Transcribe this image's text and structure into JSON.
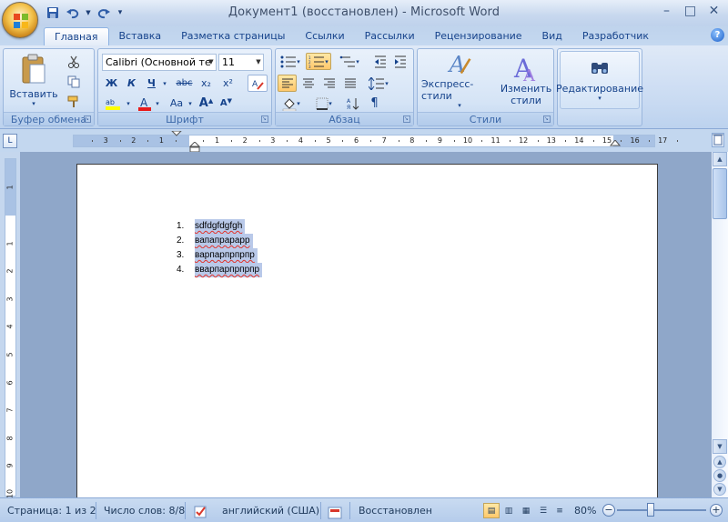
{
  "window": {
    "title": "Документ1 (восстановлен) - Microsoft Word",
    "controls": [
      "–",
      "□",
      "✕"
    ]
  },
  "qat": {
    "save_icon": "floppy-disk-icon",
    "undo_icon": "undo-icon",
    "redo_icon": "redo-icon"
  },
  "tabs": [
    {
      "label": "Главная",
      "active": true
    },
    {
      "label": "Вставка"
    },
    {
      "label": "Разметка страницы"
    },
    {
      "label": "Ссылки"
    },
    {
      "label": "Рассылки"
    },
    {
      "label": "Рецензирование"
    },
    {
      "label": "Вид"
    },
    {
      "label": "Разработчик"
    }
  ],
  "ribbon": {
    "clipboard": {
      "label": "Буфер обмена",
      "paste_label": "Вставить"
    },
    "font": {
      "label": "Шрифт",
      "font_name": "Calibri (Основной те",
      "font_size": "11",
      "bold": "Ж",
      "italic": "К",
      "underline": "Ч",
      "strike": "abc",
      "subscript": "x₂",
      "superscript": "x²",
      "case": "Aa",
      "grow": "A",
      "shrink": "A"
    },
    "paragraph": {
      "label": "Абзац"
    },
    "styles": {
      "label": "Стили",
      "express_styles": "Экспресс-стили",
      "change_styles_1": "Изменить",
      "change_styles_2": "стили"
    },
    "editing": {
      "label": "Редактирование"
    }
  },
  "ruler": {
    "numbers": [
      "3",
      "2",
      "1",
      "1",
      "2",
      "3",
      "4",
      "5",
      "6",
      "7",
      "8",
      "9",
      "10",
      "11",
      "12",
      "13",
      "14",
      "15",
      "16",
      "17"
    ],
    "vnumbers": [
      "1",
      "1",
      "2",
      "3",
      "4",
      "5",
      "6",
      "7",
      "8",
      "9",
      "10"
    ]
  },
  "document": {
    "list": [
      {
        "num": "1.",
        "text": "sdfdgfdgfgh"
      },
      {
        "num": "2.",
        "text": "вапапрарарр"
      },
      {
        "num": "3.",
        "text": "варпарпрпрпр"
      },
      {
        "num": "4.",
        "text": "вварпарпрпрпр"
      }
    ]
  },
  "status": {
    "page": "Страница: 1 из 2",
    "words": "Число слов: 8/8",
    "language": "английский (США)",
    "restored": "Восстановлен",
    "zoom": "80%",
    "zoom_minus": "−",
    "zoom_plus": "+"
  }
}
